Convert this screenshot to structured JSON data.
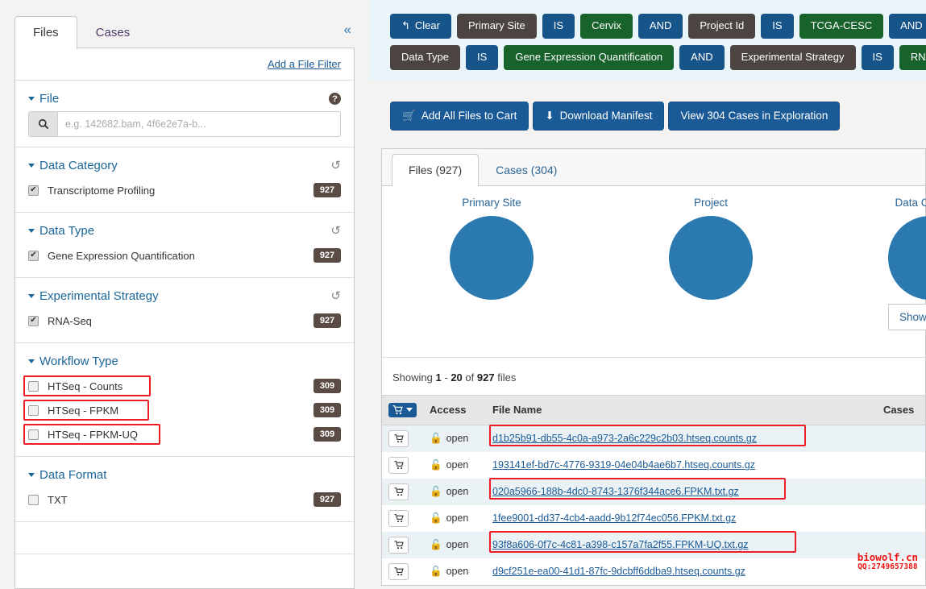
{
  "sidebar": {
    "tabs": [
      {
        "label": "Files",
        "active": true
      },
      {
        "label": "Cases",
        "active": false
      }
    ],
    "collapse_icon": "double-chevron-left-icon",
    "add_filter_label": "Add a File Filter",
    "file_facet": {
      "title": "File",
      "help_icon": "?",
      "search_icon": "search-icon",
      "search_value": "",
      "search_placeholder": "e.g. 142682.bam, 4f6e2e7a-b..."
    },
    "facets": [
      {
        "title": "Data Category",
        "reset_icon": "reset-icon",
        "items": [
          {
            "label": "Transcriptome Profiling",
            "count": "927",
            "checked": true,
            "highlighted": false
          }
        ]
      },
      {
        "title": "Data Type",
        "reset_icon": "reset-icon",
        "items": [
          {
            "label": "Gene Expression Quantification",
            "count": "927",
            "checked": true,
            "highlighted": false
          }
        ]
      },
      {
        "title": "Experimental Strategy",
        "reset_icon": "reset-icon",
        "items": [
          {
            "label": "RNA-Seq",
            "count": "927",
            "checked": true,
            "highlighted": false
          }
        ]
      },
      {
        "title": "Workflow Type",
        "reset_icon": "",
        "items": [
          {
            "label": "HTSeq - Counts",
            "count": "309",
            "checked": false,
            "highlighted": true
          },
          {
            "label": "HTSeq - FPKM",
            "count": "309",
            "checked": false,
            "highlighted": true
          },
          {
            "label": "HTSeq - FPKM-UQ",
            "count": "309",
            "checked": false,
            "highlighted": true
          }
        ]
      },
      {
        "title": "Data Format",
        "reset_icon": "",
        "items": [
          {
            "label": "TXT",
            "count": "927",
            "checked": false,
            "highlighted": false
          }
        ]
      }
    ]
  },
  "filter_bar": {
    "rows": [
      [
        {
          "text": "Clear",
          "style": "blue",
          "icon": "undo-arrow-icon"
        },
        {
          "text": "Primary Site",
          "style": "dark",
          "icon": ""
        },
        {
          "text": "IS",
          "style": "blue",
          "icon": ""
        },
        {
          "text": "Cervix",
          "style": "green",
          "icon": ""
        },
        {
          "text": "AND",
          "style": "blue",
          "icon": ""
        },
        {
          "text": "Project Id",
          "style": "dark",
          "icon": ""
        },
        {
          "text": "IS",
          "style": "blue",
          "icon": ""
        },
        {
          "text": "TCGA-CESC",
          "style": "green",
          "icon": ""
        },
        {
          "text": "AND",
          "style": "blue",
          "icon": ""
        },
        {
          "text": "",
          "style": "dark",
          "icon": ""
        }
      ],
      [
        {
          "text": "Data Type",
          "style": "dark",
          "icon": ""
        },
        {
          "text": "IS",
          "style": "blue",
          "icon": ""
        },
        {
          "text": "Gene Expression Quantification",
          "style": "green",
          "icon": ""
        },
        {
          "text": "AND",
          "style": "blue",
          "icon": ""
        },
        {
          "text": "Experimental Strategy",
          "style": "dark",
          "icon": ""
        },
        {
          "text": "IS",
          "style": "blue",
          "icon": ""
        },
        {
          "text": "RNA-Seq",
          "style": "green",
          "icon": ""
        }
      ]
    ]
  },
  "actions": [
    {
      "label": "Add All Files to Cart",
      "icon": "shopping-cart-icon"
    },
    {
      "label": "Download Manifest",
      "icon": "download-icon"
    },
    {
      "label": "View 304 Cases in Exploration",
      "icon": ""
    }
  ],
  "content": {
    "tabs": [
      {
        "label": "Files (927)",
        "active": true
      },
      {
        "label": "Cases (304)",
        "active": false
      }
    ],
    "show_more_label": "Show More",
    "showing": {
      "prefix": "Showing",
      "from": "1",
      "dash": "-",
      "to": "20",
      "of": "of",
      "total": "927",
      "suffix": "files"
    },
    "table": {
      "headers": [
        "",
        "Access",
        "File Name",
        "Cases"
      ],
      "rows": [
        {
          "access": "open",
          "file_name": "d1b25b91-db55-4c0a-a973-2a6c229c2b03.htseq.counts.gz",
          "cases": "",
          "highlighted": true
        },
        {
          "access": "open",
          "file_name": "193141ef-bd7c-4776-9319-04e04b4ae6b7.htseq.counts.gz",
          "cases": "",
          "highlighted": false
        },
        {
          "access": "open",
          "file_name": "020a5966-188b-4dc0-8743-1376f344ace6.FPKM.txt.gz",
          "cases": "",
          "highlighted": true
        },
        {
          "access": "open",
          "file_name": "1fee9001-dd37-4cb4-aadd-9b12f74ec056.FPKM.txt.gz",
          "cases": "",
          "highlighted": false
        },
        {
          "access": "open",
          "file_name": "93f8a606-0f7c-4c81-a398-c157a7fa2f55.FPKM-UQ.txt.gz",
          "cases": "",
          "highlighted": true
        },
        {
          "access": "open",
          "file_name": "d9cf251e-ea00-41d1-87fc-9dcbff6ddba9.htseq.counts.gz",
          "cases": "",
          "highlighted": false
        }
      ]
    }
  },
  "chart_data": [
    {
      "type": "pie",
      "title": "Primary Site",
      "categories": [
        "Cervix"
      ],
      "values": [
        927
      ],
      "colors": [
        "#2a7ab0"
      ],
      "legend": "none"
    },
    {
      "type": "pie",
      "title": "Project",
      "categories": [
        "TCGA-CESC"
      ],
      "values": [
        927
      ],
      "colors": [
        "#2a7ab0"
      ],
      "legend": "none"
    },
    {
      "type": "pie",
      "title": "Data Category",
      "categories": [
        "Transcriptome Profiling"
      ],
      "values": [
        927
      ],
      "colors": [
        "#2a7ab0"
      ],
      "legend": "none"
    }
  ],
  "watermark": {
    "line1": "biowolf.cn",
    "line2": "QQ:2749657388",
    "color": "#ee1111"
  }
}
